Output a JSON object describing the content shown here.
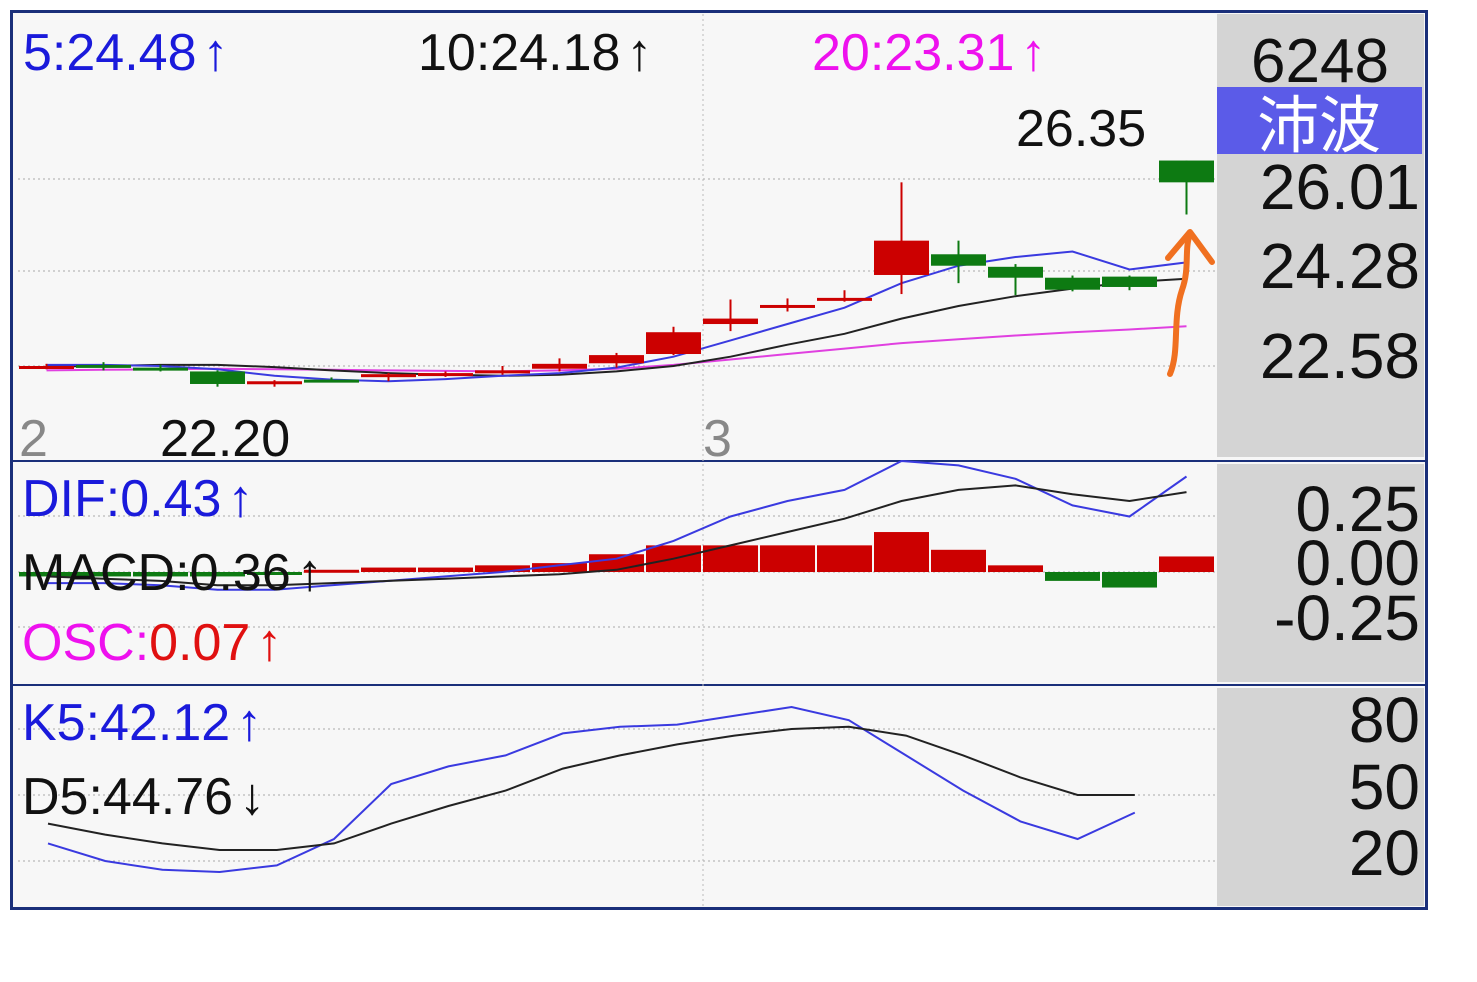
{
  "stock": {
    "code": "6248",
    "name": "沛波"
  },
  "price_panel": {
    "ma_labels": [
      {
        "text": "5:24.48",
        "arrow": "↑",
        "color": "#1a1adb"
      },
      {
        "text": "10:24.18",
        "arrow": "↑",
        "color": "#111111"
      },
      {
        "text": "20:23.31",
        "arrow": "↑",
        "color": "#ee11ee"
      }
    ],
    "y_ticks": [
      "26.01",
      "24.28",
      "22.58"
    ],
    "high_label": "26.35",
    "low_label": "22.20",
    "month_labels": [
      "2",
      "3"
    ]
  },
  "macd_panel": {
    "labels": [
      {
        "name": "DIF",
        "value": "0.43",
        "arrow": "↑",
        "color": "#1a1adb"
      },
      {
        "name": "MACD",
        "value": "0.36",
        "arrow": "↑",
        "color": "#111111"
      },
      {
        "name": "OSC",
        "value": "0.07",
        "arrow": "↑",
        "color": "#ee11ee",
        "value_color": "#e01010"
      }
    ],
    "y_ticks": [
      "0.25",
      "0.00",
      "-0.25"
    ]
  },
  "kd_panel": {
    "labels": [
      {
        "name": "K5",
        "value": "42.12",
        "arrow": "↑",
        "color": "#1a1adb"
      },
      {
        "name": "D5",
        "value": "44.76",
        "arrow": "↓",
        "color": "#111111"
      }
    ],
    "y_ticks": [
      "80",
      "50",
      "20"
    ]
  },
  "colors": {
    "up": "#cc0000",
    "down": "#0d7a12",
    "ma5": "#3a3ae0",
    "ma10": "#222222",
    "ma20": "#e040e0",
    "annotation": "#f07020",
    "frame": "#1a2f7a",
    "axis_bg": "#d4d4d4"
  },
  "chart_data": [
    {
      "type": "candlestick",
      "title": "",
      "ylim": [
        21.8,
        26.9
      ],
      "y_ticks": [
        26.01,
        24.28,
        22.58
      ],
      "candles": [
        {
          "o": 22.58,
          "h": 22.62,
          "l": 22.52,
          "c": 22.58
        },
        {
          "o": 22.6,
          "h": 22.65,
          "l": 22.5,
          "c": 22.55
        },
        {
          "o": 22.55,
          "h": 22.6,
          "l": 22.48,
          "c": 22.52
        },
        {
          "o": 22.48,
          "h": 22.5,
          "l": 22.2,
          "c": 22.25
        },
        {
          "o": 22.25,
          "h": 22.32,
          "l": 22.2,
          "c": 22.3
        },
        {
          "o": 22.33,
          "h": 22.37,
          "l": 22.3,
          "c": 22.3
        },
        {
          "o": 22.38,
          "h": 22.45,
          "l": 22.3,
          "c": 22.43
        },
        {
          "o": 22.43,
          "h": 22.48,
          "l": 22.38,
          "c": 22.45
        },
        {
          "o": 22.48,
          "h": 22.58,
          "l": 22.42,
          "c": 22.5
        },
        {
          "o": 22.53,
          "h": 22.72,
          "l": 22.48,
          "c": 22.62
        },
        {
          "o": 22.63,
          "h": 22.82,
          "l": 22.55,
          "c": 22.78
        },
        {
          "o": 22.8,
          "h": 23.3,
          "l": 22.78,
          "c": 23.2
        },
        {
          "o": 23.35,
          "h": 23.8,
          "l": 23.22,
          "c": 23.45
        },
        {
          "o": 23.65,
          "h": 23.82,
          "l": 23.58,
          "c": 23.7
        },
        {
          "o": 23.83,
          "h": 23.97,
          "l": 23.76,
          "c": 23.83
        },
        {
          "o": 24.25,
          "h": 25.95,
          "l": 23.9,
          "c": 24.88
        },
        {
          "o": 24.63,
          "h": 24.88,
          "l": 24.1,
          "c": 24.42
        },
        {
          "o": 24.4,
          "h": 24.45,
          "l": 23.88,
          "c": 24.2
        },
        {
          "o": 24.2,
          "h": 24.24,
          "l": 23.95,
          "c": 23.98
        },
        {
          "o": 24.22,
          "h": 24.24,
          "l": 23.97,
          "c": 24.03
        },
        {
          "o": 26.35,
          "h": 26.35,
          "l": 25.36,
          "c": 25.95
        }
      ],
      "series": [
        {
          "name": "5",
          "values": [
            22.6,
            22.6,
            22.58,
            22.52,
            22.4,
            22.33,
            22.3,
            22.34,
            22.4,
            22.45,
            22.55,
            22.75,
            23.05,
            23.35,
            23.65,
            24.1,
            24.42,
            24.58,
            24.68,
            24.35,
            24.48
          ]
        },
        {
          "name": "10",
          "values": [
            22.57,
            22.58,
            22.6,
            22.6,
            22.56,
            22.5,
            22.45,
            22.42,
            22.4,
            22.42,
            22.48,
            22.58,
            22.75,
            22.97,
            23.17,
            23.45,
            23.68,
            23.86,
            24.0,
            24.12,
            24.18
          ]
        },
        {
          "name": "20",
          "values": [
            22.5,
            22.51,
            22.52,
            22.53,
            22.52,
            22.51,
            22.5,
            22.49,
            22.48,
            22.5,
            22.53,
            22.6,
            22.7,
            22.8,
            22.9,
            23.0,
            23.07,
            23.14,
            23.2,
            23.25,
            23.31
          ]
        }
      ]
    },
    {
      "type": "bar",
      "title": "",
      "ylim": [
        -0.42,
        0.5
      ],
      "y_ticks": [
        0.25,
        0.0,
        -0.25
      ],
      "osc": [
        -0.02,
        -0.02,
        -0.02,
        -0.02,
        -0.01,
        0.01,
        0.02,
        0.02,
        0.03,
        0.04,
        0.08,
        0.12,
        0.12,
        0.12,
        0.12,
        0.18,
        0.1,
        0.03,
        -0.04,
        -0.07,
        0.07
      ],
      "series": [
        {
          "name": "DIF",
          "values": [
            -0.05,
            -0.05,
            -0.06,
            -0.08,
            -0.08,
            -0.06,
            -0.04,
            -0.02,
            0.0,
            0.03,
            0.06,
            0.14,
            0.25,
            0.32,
            0.37,
            0.5,
            0.48,
            0.42,
            0.3,
            0.25,
            0.43
          ]
        },
        {
          "name": "MACD",
          "values": [
            -0.02,
            -0.03,
            -0.04,
            -0.06,
            -0.06,
            -0.05,
            -0.04,
            -0.03,
            -0.02,
            -0.01,
            0.01,
            0.06,
            0.12,
            0.18,
            0.24,
            0.32,
            0.37,
            0.39,
            0.35,
            0.32,
            0.36
          ]
        }
      ]
    },
    {
      "type": "line",
      "title": "",
      "ylim": [
        0,
        100
      ],
      "y_ticks": [
        80,
        50,
        20
      ],
      "series": [
        {
          "name": "K5",
          "values": [
            28,
            20,
            16,
            15,
            18,
            30,
            55,
            63,
            68,
            78,
            81,
            82,
            86,
            90,
            84,
            68,
            52,
            38,
            30,
            42
          ]
        },
        {
          "name": "D5",
          "values": [
            37,
            32,
            28,
            25,
            25,
            28,
            37,
            45,
            52,
            62,
            68,
            73,
            77,
            80,
            81,
            77,
            68,
            58,
            50,
            50
          ]
        }
      ]
    }
  ]
}
